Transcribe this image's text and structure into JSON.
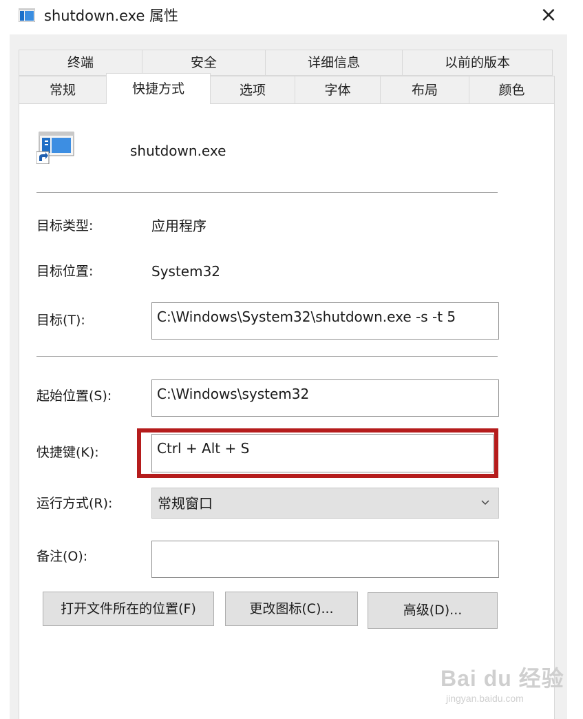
{
  "window": {
    "title": "shutdown.exe 属性",
    "close_glyph": "×"
  },
  "tabs": {
    "row1": [
      {
        "label": "终端"
      },
      {
        "label": "安全"
      },
      {
        "label": "详细信息"
      },
      {
        "label": "以前的版本"
      }
    ],
    "row2": [
      {
        "label": "常规"
      },
      {
        "label": "快捷方式",
        "active": true
      },
      {
        "label": "选项"
      },
      {
        "label": "字体"
      },
      {
        "label": "布局"
      },
      {
        "label": "颜色"
      }
    ]
  },
  "shortcut": {
    "file_name": "shutdown.exe",
    "target_type_label": "目标类型:",
    "target_type_value": "应用程序",
    "target_location_label": "目标位置:",
    "target_location_value": "System32",
    "target_label": "目标(T):",
    "target_value": "C:\\Windows\\System32\\shutdown.exe -s -t 5",
    "start_in_label": "起始位置(S):",
    "start_in_value": "C:\\Windows\\system32",
    "hotkey_label": "快捷键(K):",
    "hotkey_value": "Ctrl + Alt + S",
    "run_label": "运行方式(R):",
    "run_value": "常规窗口",
    "comment_label": "备注(O):",
    "comment_value": ""
  },
  "buttons": {
    "open_location": "打开文件所在的位置(F)",
    "change_icon": "更改图标(C)...",
    "advanced": "高级(D)..."
  },
  "watermark": {
    "main": "Bai du 经验",
    "sub": "jingyan.baidu.com"
  },
  "colors": {
    "highlight": "#b51c1c",
    "dialog_bg": "#f0f0f0",
    "button_bg": "#e1e1e1"
  }
}
